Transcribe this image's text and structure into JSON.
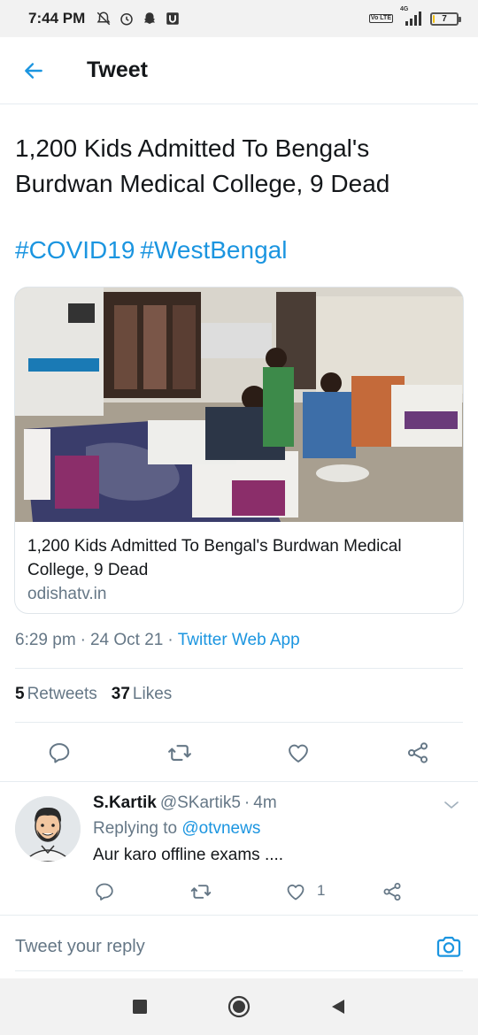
{
  "status_bar": {
    "time": "7:44 PM",
    "network": "4G",
    "lte": "Vo LTE",
    "battery": "7",
    "battery_level": 0.07,
    "battery_color": "#f4c20d"
  },
  "header": {
    "title": "Tweet"
  },
  "tweet": {
    "text": "1,200 Kids Admitted To Bengal's Burdwan Medical College, 9 Dead",
    "hashtags": [
      "#COVID19",
      "#WestBengal"
    ],
    "link_card": {
      "title": "1,200 Kids Admitted To Bengal's Burdwan Medical College, 9 Dead",
      "domain": "odishatv.in",
      "image_icon": "hospital-ward-photo"
    },
    "time": "6:29 pm",
    "date": "24 Oct 21",
    "source": "Twitter Web App",
    "separator": "·",
    "retweets_count": "5",
    "retweets_label": "Retweets",
    "likes_count": "37",
    "likes_label": "Likes"
  },
  "reply": {
    "name": "S.Kartik",
    "handle": "@SKartik5",
    "separator": "·",
    "age": "4m",
    "replying_prefix": "Replying to",
    "replying_handle": "@otvnews",
    "text": "Aur karo offline exams ....",
    "like_count": "1"
  },
  "compose": {
    "placeholder": "Tweet your reply"
  },
  "colors": {
    "accent": "#1b95e0",
    "secondary_text": "#657786",
    "primary_text": "#14171a",
    "border": "#e6ecf0"
  },
  "icons": {
    "back": "arrow-left-icon",
    "reply": "comment-icon",
    "retweet": "retweet-icon",
    "like": "heart-icon",
    "share": "share-icon",
    "camera": "camera-icon",
    "more": "chevron-down-icon"
  }
}
